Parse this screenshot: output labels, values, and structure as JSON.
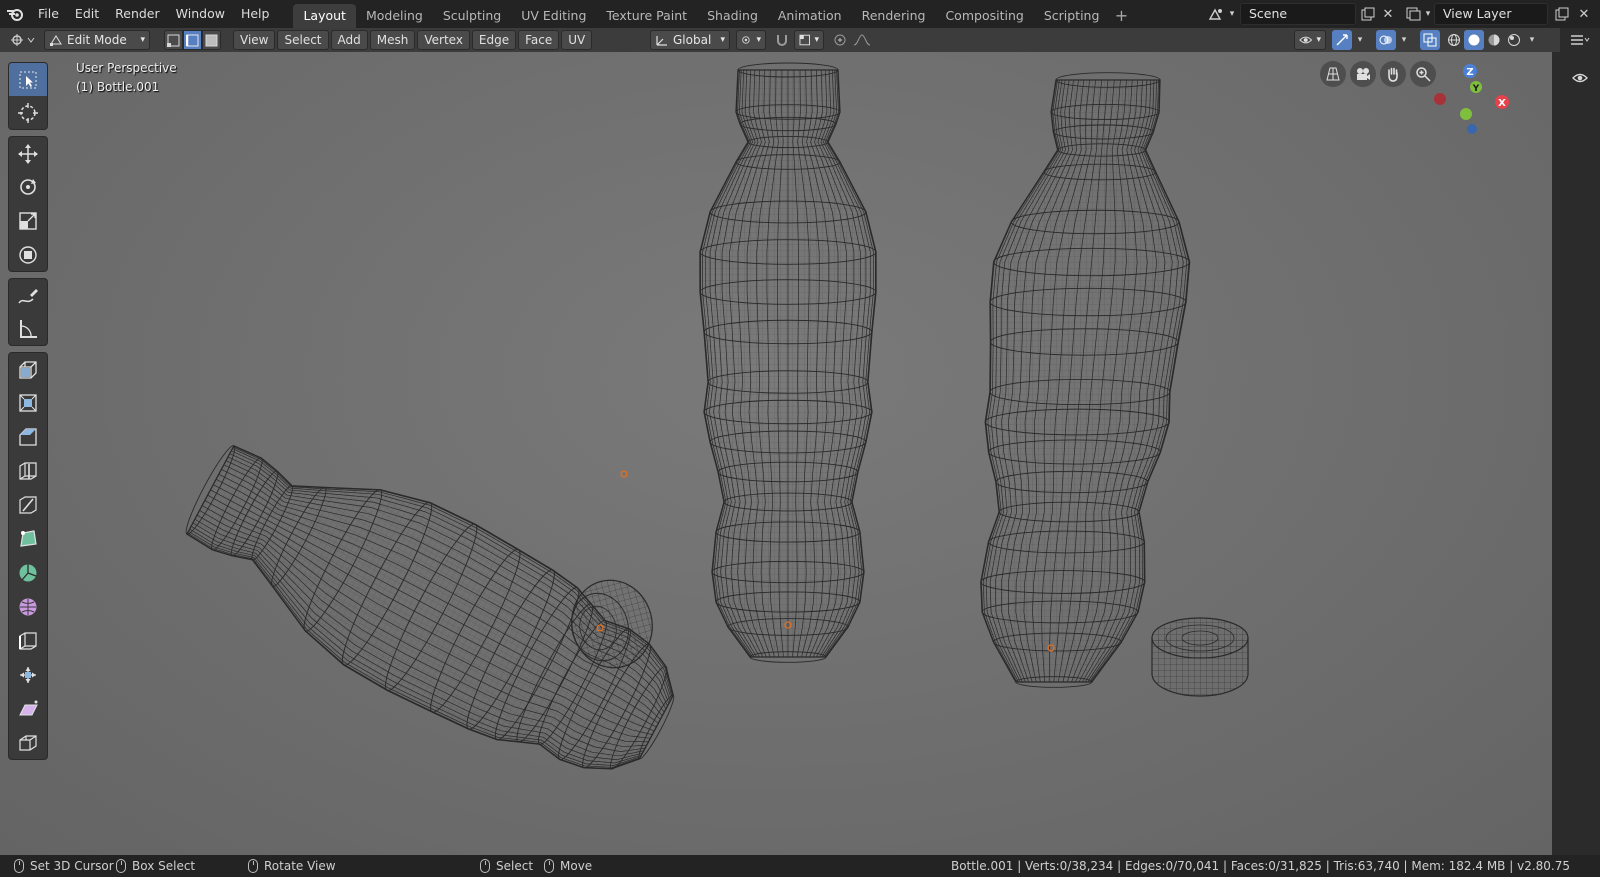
{
  "menubar": {
    "items": [
      "File",
      "Edit",
      "Render",
      "Window",
      "Help"
    ]
  },
  "workspaces": {
    "tabs": [
      "Layout",
      "Modeling",
      "Sculpting",
      "UV Editing",
      "Texture Paint",
      "Shading",
      "Animation",
      "Rendering",
      "Compositing",
      "Scripting"
    ],
    "active": "Layout",
    "add_symbol": "+"
  },
  "scene": {
    "name": "Scene"
  },
  "view_layer": {
    "name": "View Layer"
  },
  "header": {
    "mode": "Edit Mode",
    "menus": [
      "View",
      "Select",
      "Add",
      "Mesh",
      "Vertex",
      "Edge",
      "Face",
      "UV"
    ],
    "transform_orientation": "Global"
  },
  "viewport": {
    "perspective_label": "User Perspective",
    "object_label": "(1) Bottle.001",
    "gizmo": {
      "z": "Z",
      "y": "Y",
      "x": "X"
    }
  },
  "statusbar": {
    "left": [
      {
        "label": "Set 3D Cursor"
      },
      {
        "label": "Box Select"
      },
      {
        "label": "Rotate View"
      },
      {
        "label": "Select"
      },
      {
        "label": "Move"
      }
    ],
    "stats": "Bottle.001 | Verts:0/38,234 | Edges:0/70,041 | Faces:0/31,825 | Tris:63,740 | Mem: 182.4 MB | v2.80.75"
  },
  "colors": {
    "accent": "#5680c2",
    "wire": "#2a2a2a",
    "x_axis": "#e8414a",
    "y_axis": "#7fbf3d",
    "z_axis": "#4a80d8"
  }
}
